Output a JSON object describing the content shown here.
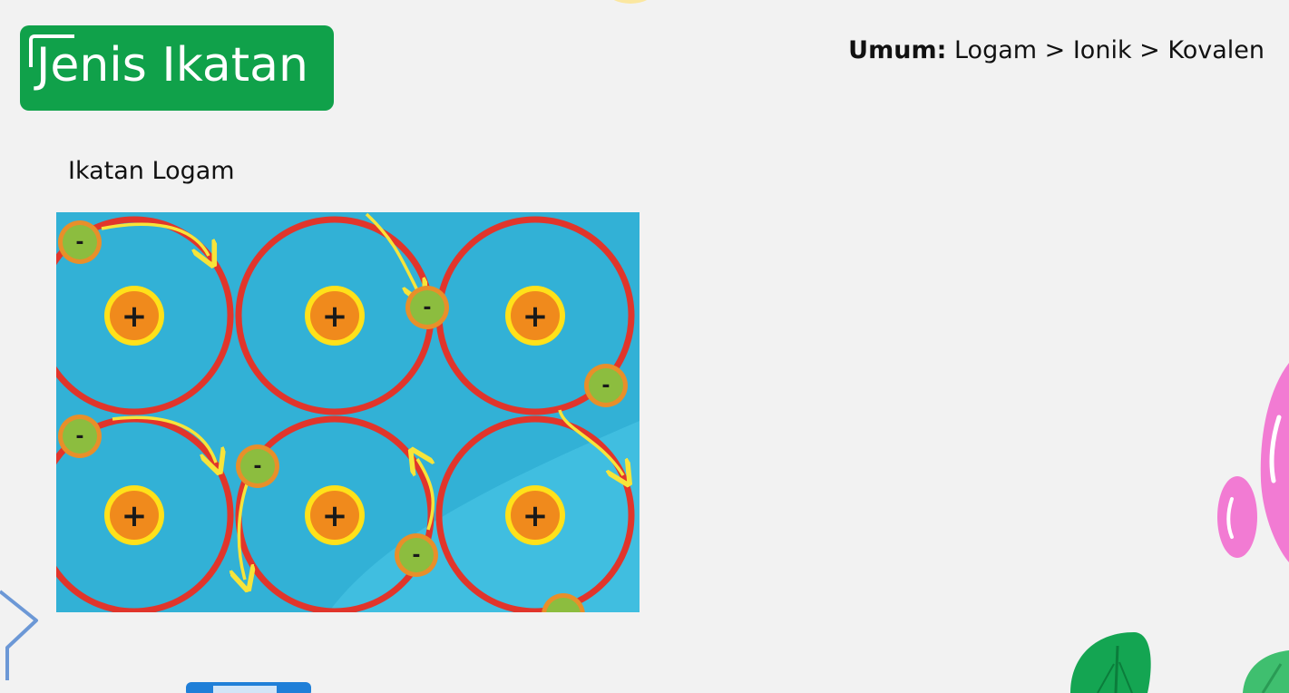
{
  "slide": {
    "title": "Jenis Ikatan",
    "rule_label": "Umum:",
    "rule_value": "Logam > Ionik > Kovalen",
    "section_title": "Ikatan Logam"
  },
  "diagram": {
    "cation_sign": "+",
    "electron_sign": "-",
    "colors": {
      "sea": "#32b1d6",
      "sea_light": "#4ac6e6",
      "ring": "#e1352b",
      "cation_fill": "#f08a1c",
      "cation_ring": "#ffe11a",
      "electron_fill": "#8cbd3f",
      "electron_ring": "#e88f2a",
      "arrow": "#f7e43a"
    }
  },
  "theme": {
    "title_bg": "#10a14a",
    "page_bg": "#f2f2f2"
  }
}
